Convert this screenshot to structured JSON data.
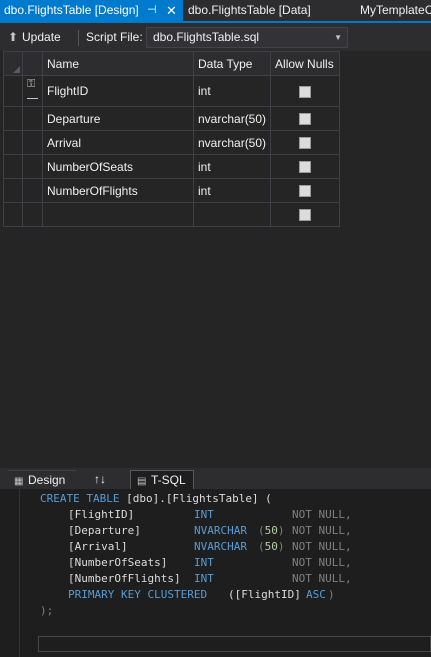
{
  "tabs": [
    {
      "label": "dbo.FlightsTable [Design]",
      "pin": "⊣",
      "close": "✕"
    },
    {
      "label": "dbo.FlightsTable [Data]"
    },
    {
      "label": "MyTemplateC"
    }
  ],
  "toolbar": {
    "update_label": "Update",
    "script_file_label": "Script File:",
    "script_file_value": "dbo.FlightsTable.sql"
  },
  "grid": {
    "headers": [
      "Name",
      "Data Type",
      "Allow Nulls"
    ],
    "rows": [
      {
        "name": "FlightID",
        "type": "int",
        "allow_nulls": false,
        "key": true
      },
      {
        "name": "Departure",
        "type": "nvarchar(50)",
        "allow_nulls": false
      },
      {
        "name": "Arrival",
        "type": "nvarchar(50)",
        "allow_nulls": false
      },
      {
        "name": "NumberOfSeats",
        "type": "int",
        "allow_nulls": false
      },
      {
        "name": "NumberOfFlights",
        "type": "int",
        "allow_nulls": false
      },
      {
        "name": "",
        "type": "",
        "allow_nulls": false
      }
    ]
  },
  "pane_tabs": {
    "design": "Design",
    "swap": "↑↓",
    "tsql": "T-SQL"
  },
  "sql": {
    "l1": {
      "kw": "CREATE TABLE",
      "rest": " [dbo].[FlightsTable] ("
    },
    "cols": [
      {
        "name": "[FlightID]",
        "type": "INT",
        "size": "",
        "null": "NOT NULL,"
      },
      {
        "name": "[Departure]",
        "type": "NVARCHAR",
        "size": "50",
        "null": "NOT NULL,"
      },
      {
        "name": "[Arrival]",
        "type": "NVARCHAR",
        "size": "50",
        "null": "NOT NULL,"
      },
      {
        "name": "[NumberOfSeats]",
        "type": "INT",
        "size": "",
        "null": "NOT NULL,"
      },
      {
        "name": "[NumberOfFlights]",
        "type": "INT",
        "size": "",
        "null": "NOT NULL,"
      }
    ],
    "pk_kw": "PRIMARY KEY CLUSTERED",
    "pk_col": "([FlightID]",
    "pk_asc": "ASC",
    "pk_close": ")",
    "end": ");"
  },
  "colors": {
    "accent": "#007acc",
    "background": "#2d2d30",
    "editor_bg": "#1e1e1e",
    "keyword": "#569cd6"
  }
}
